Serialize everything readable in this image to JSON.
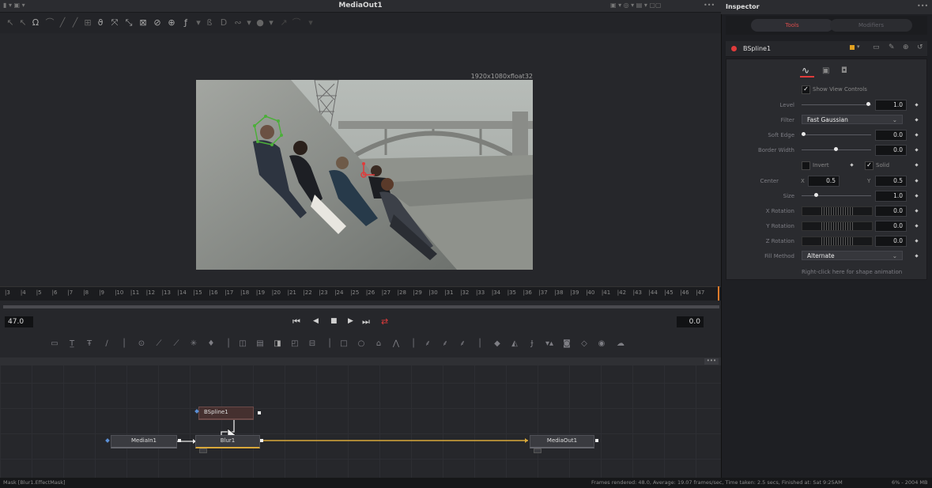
{
  "viewer": {
    "title": "MediaOut1",
    "resolution": "1920x1080xfloat32",
    "menu_dots": "•••"
  },
  "timeline": {
    "ticks": [
      "3",
      "4",
      "5",
      "6",
      "7",
      "8",
      "9",
      "10",
      "11",
      "12",
      "13",
      "14",
      "15",
      "16",
      "17",
      "18",
      "19",
      "20",
      "21",
      "22",
      "23",
      "24",
      "25",
      "26",
      "27",
      "28",
      "29",
      "30",
      "31",
      "32",
      "33",
      "34",
      "35",
      "36",
      "37",
      "38",
      "39",
      "40",
      "41",
      "42",
      "43",
      "44",
      "45",
      "46",
      "47"
    ],
    "current_frame": "47.0",
    "end_value": "0.0"
  },
  "transport": {
    "prev_glyph": "⏮",
    "step_back_glyph": "◀",
    "stop_glyph": "■",
    "play_glyph": "▶",
    "next_glyph": "⏭",
    "loop_glyph": "⇄"
  },
  "flow": {
    "nodes": {
      "bspline": "BSpline1",
      "mediain": "MediaIn1",
      "blur": "Blur1",
      "mediaout": "MediaOut1"
    },
    "menu_dots": "•••"
  },
  "status": {
    "left": "Mask [Blur1.EffectMask]",
    "right": "Frames rendered: 48.0, Average: 19.07 frames/sec, Time taken: 2.5 secs, Finished at: Sat 9:25AM",
    "memory": "6% - 2004 MB"
  },
  "inspector": {
    "title": "Inspector",
    "menu_dots": "•••",
    "tabs": {
      "tools": "Tools",
      "modifiers": "Modifiers"
    },
    "node_name": "BSpline1",
    "show_view_controls": "Show View Controls",
    "level": {
      "label": "Level",
      "value": "1.0"
    },
    "filter": {
      "label": "Filter",
      "value": "Fast Gaussian"
    },
    "soft_edge": {
      "label": "Soft Edge",
      "value": "0.0"
    },
    "border_width": {
      "label": "Border Width",
      "value": "0.0"
    },
    "invert": "Invert",
    "solid": "Solid",
    "center": {
      "label": "Center",
      "x_label": "X",
      "x_value": "0.5",
      "y_label": "Y",
      "y_value": "0.5"
    },
    "size": {
      "label": "Size",
      "value": "1.0"
    },
    "x_rotation": {
      "label": "X Rotation",
      "value": "0.0"
    },
    "y_rotation": {
      "label": "Y Rotation",
      "value": "0.0"
    },
    "z_rotation": {
      "label": "Z Rotation",
      "value": "0.0"
    },
    "fill_method": {
      "label": "Fill Method",
      "value": "Alternate"
    },
    "hint": "Right-click here for shape animation"
  },
  "colors": {
    "accent_red": "#e03b3b",
    "connection_yellow": "#d9a83a",
    "panel_bg": "#2a2b2f"
  }
}
